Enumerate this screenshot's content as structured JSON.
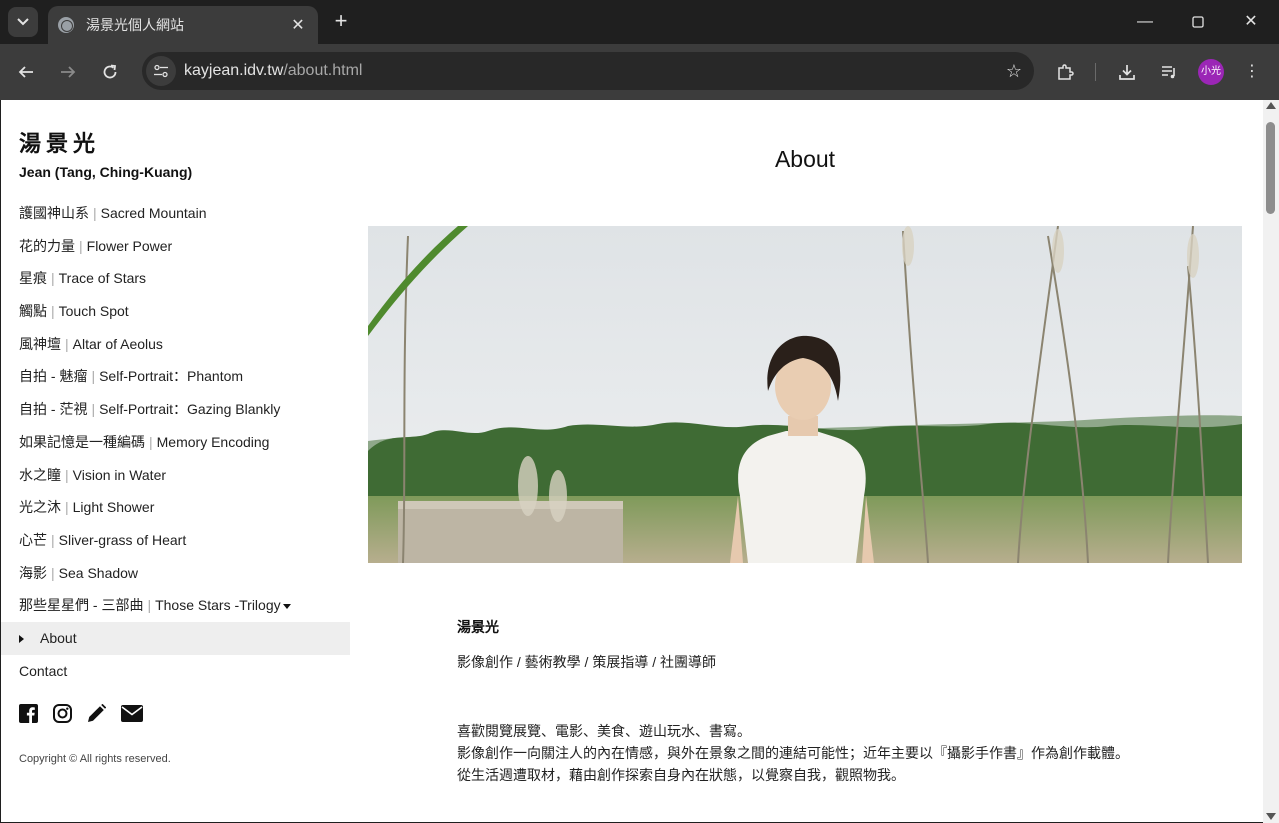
{
  "browser": {
    "tab_title": "湯景光個人網站",
    "url_host": "kayjean.idv.tw",
    "url_path": "/about.html",
    "profile_label": "小光",
    "icons": [
      "tab-search-icon",
      "globe-icon",
      "close-icon",
      "plus-icon",
      "minimize-icon",
      "maximize-icon",
      "window-close-icon",
      "back-icon",
      "forward-icon",
      "reload-icon",
      "site-info-icon",
      "star-icon",
      "extensions-icon",
      "download-icon",
      "media-icon",
      "menu-icon"
    ]
  },
  "sidebar": {
    "site_name": "湯景光",
    "subtitle": "Jean (Tang, Ching-Kuang)",
    "items": [
      {
        "zh": "護國神山系",
        "en": "Sacred Mountain"
      },
      {
        "zh": "花的力量",
        "en": "Flower Power"
      },
      {
        "zh": "星痕",
        "en": "Trace of Stars"
      },
      {
        "zh": "觸點",
        "en": "Touch Spot"
      },
      {
        "zh": "風神壇",
        "en": "Altar of Aeolus"
      },
      {
        "zh": "自拍 - 魅瘤",
        "en": "Self-Portrait：Phantom"
      },
      {
        "zh": "自拍 - 茫視",
        "en": "Self-Portrait：Gazing Blankly"
      },
      {
        "zh": "如果記憶是一種編碼",
        "en": "Memory Encoding"
      },
      {
        "zh": "水之瞳",
        "en": "Vision in Water"
      },
      {
        "zh": "光之沐",
        "en": "Light Shower"
      },
      {
        "zh": "心芒",
        "en": "Sliver-grass of Heart"
      },
      {
        "zh": "海影",
        "en": "Sea Shadow"
      },
      {
        "zh": "那些星星們 - 三部曲",
        "en": "Those Stars -Trilogy"
      }
    ],
    "separator": "|",
    "about_label": "About",
    "contact_label": "Contact",
    "social_icons": [
      "facebook-icon",
      "instagram-icon",
      "pencil-icon",
      "envelope-icon"
    ],
    "copyright": "Copyright © All rights reserved."
  },
  "main": {
    "heading": "About",
    "bio_name": "湯景光",
    "bio_roles": "影像創作 / 藝術教學 / 策展指導 / 社團導師",
    "bio_lines": [
      "喜歡閱覽展覽、電影、美食、遊山玩水、書寫。",
      "影像創作一向關注人的內在情感，與外在景象之間的連結可能性；近年主要以『攝影手作書』作為創作載體。",
      "從生活週遭取材，藉由創作探索自身內在狀態，以覺察自我，觀照物我。"
    ]
  },
  "colors": {
    "chrome_dark": "#1f1f1f",
    "chrome_toolbar": "#3c3c3c",
    "profile": "#9b26b6",
    "active_menu_bg": "#eeeeee"
  }
}
